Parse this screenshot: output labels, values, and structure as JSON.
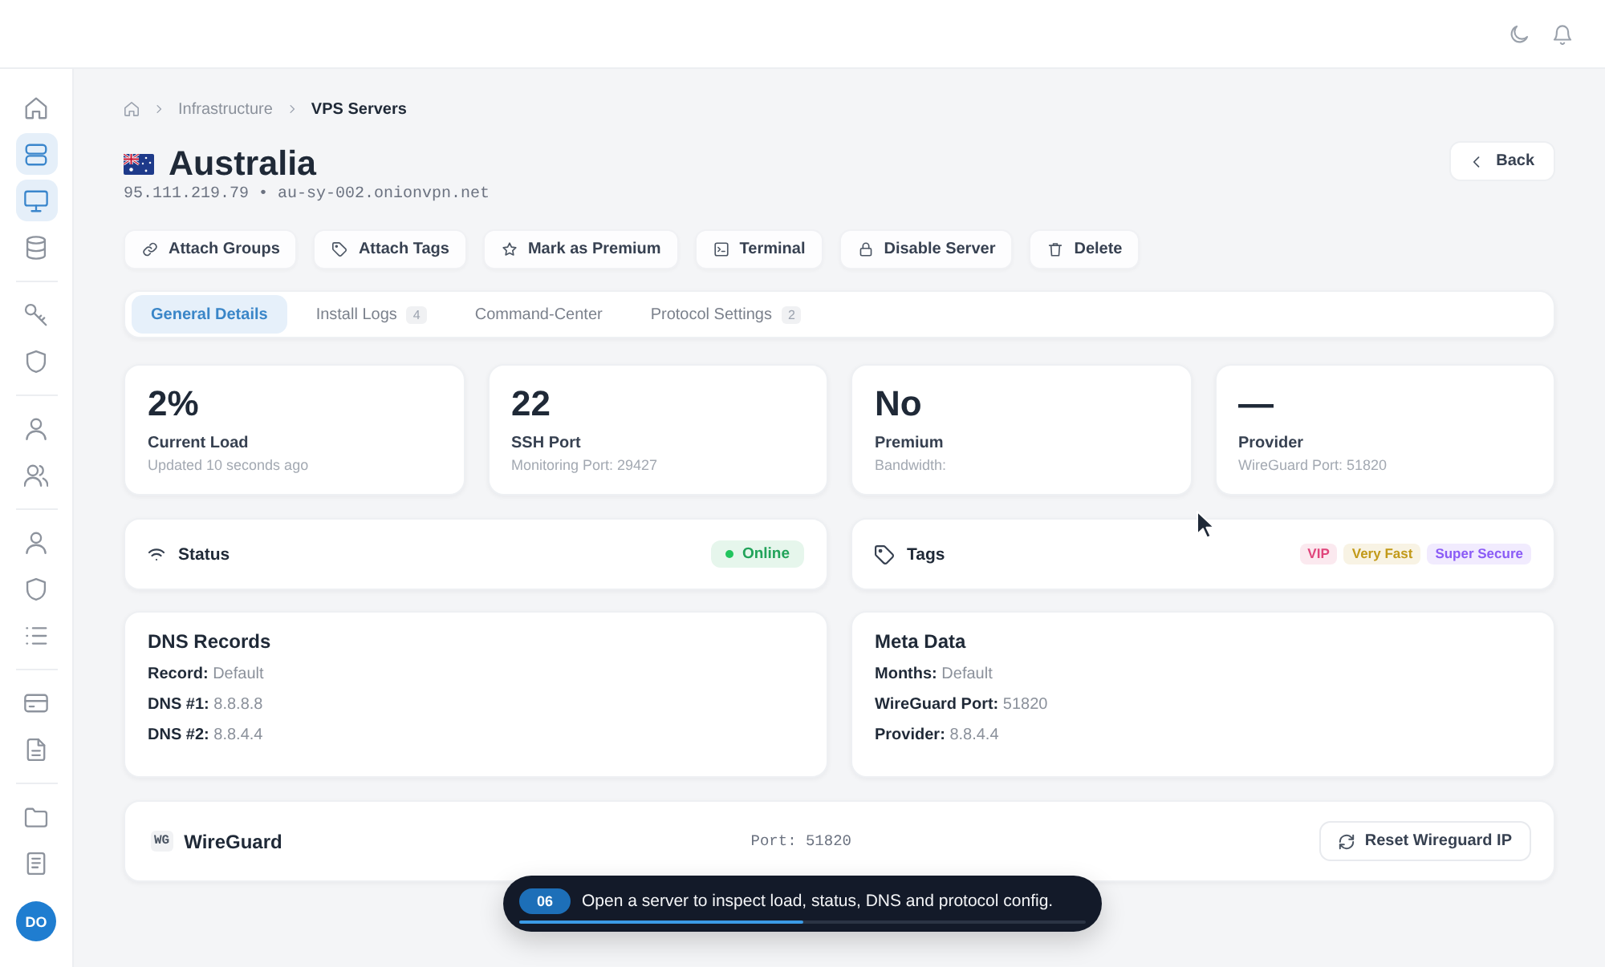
{
  "sidebar": {
    "groups": [
      {
        "items": [
          {
            "selected": false
          },
          {
            "selected": true
          },
          {
            "selected": true
          },
          {
            "selected": false
          }
        ]
      },
      {
        "items": [
          {
            "selected": false
          },
          {
            "selected": false
          }
        ]
      },
      {
        "items": [
          {
            "selected": false
          },
          {
            "selected": false
          }
        ]
      },
      {
        "items": [
          {
            "selected": false
          },
          {
            "selected": false
          },
          {
            "selected": false
          }
        ]
      },
      {
        "items": [
          {
            "selected": false
          },
          {
            "selected": false
          }
        ]
      },
      {
        "items": [
          {
            "selected": false
          },
          {
            "selected": false
          }
        ]
      }
    ],
    "avatar": {
      "initials": "DO"
    }
  },
  "breadcrumb": [
    {
      "label": "Infrastructure",
      "current": false
    },
    {
      "label": "VPS Servers",
      "current": true
    }
  ],
  "server": {
    "name": "Australia",
    "address": "95.111.219.79 • au-sy-002.onionvpn.net"
  },
  "back_button": {
    "label": "Back"
  },
  "actions": [
    {
      "label": "Attach Groups"
    },
    {
      "label": "Attach Tags"
    },
    {
      "label": "Mark as Premium"
    },
    {
      "label": "Terminal"
    },
    {
      "label": "Disable Server"
    },
    {
      "label": "Delete"
    }
  ],
  "tabs": [
    {
      "label": "General Details",
      "selected": true
    },
    {
      "label": "Install Logs",
      "count": "4",
      "selected": false
    },
    {
      "label": "Command-Center",
      "selected": false
    },
    {
      "label": "Protocol Settings",
      "count": "2",
      "selected": false
    }
  ],
  "stats": [
    {
      "value": "2%",
      "label": "Current Load",
      "detail": "Updated 10 seconds ago"
    },
    {
      "value": "22",
      "label": "SSH Port",
      "detail": "Monitoring Port: 29427"
    },
    {
      "value": "No",
      "label": "Premium",
      "detail": "Bandwidth:"
    },
    {
      "value": "—",
      "label": "Provider",
      "detail": "WireGuard Port: 51820"
    }
  ],
  "status": {
    "title": "Status",
    "value": "Online",
    "online": true
  },
  "tags": {
    "title": "Tags",
    "items": [
      {
        "label": "VIP",
        "color": "#e0457b"
      },
      {
        "label": "Very Fast",
        "color": "#c29a1a"
      },
      {
        "label": "Super Secure",
        "color": "#8b5cf6"
      }
    ]
  },
  "dns_records": {
    "title": "DNS Records",
    "rows": [
      {
        "label": "Record:",
        "value": "Default"
      },
      {
        "label": "DNS #1:",
        "value": "8.8.8.8"
      },
      {
        "label": "DNS #2:",
        "value": "8.8.4.4"
      }
    ]
  },
  "meta_data": {
    "title": "Meta Data",
    "rows": [
      {
        "label": "Months:",
        "value": "Default"
      },
      {
        "label": "WireGuard Port:",
        "value": "51820"
      },
      {
        "label": "Provider:",
        "value": "8.8.4.4"
      }
    ]
  },
  "wireguard": {
    "badge": "WG",
    "title": "WireGuard",
    "port": "Port: 51820",
    "button": "Reset Wireguard IP"
  },
  "toast": {
    "step": "06",
    "message": "Open a server to inspect load, status, DNS and protocol config.",
    "level": 0.5
  }
}
